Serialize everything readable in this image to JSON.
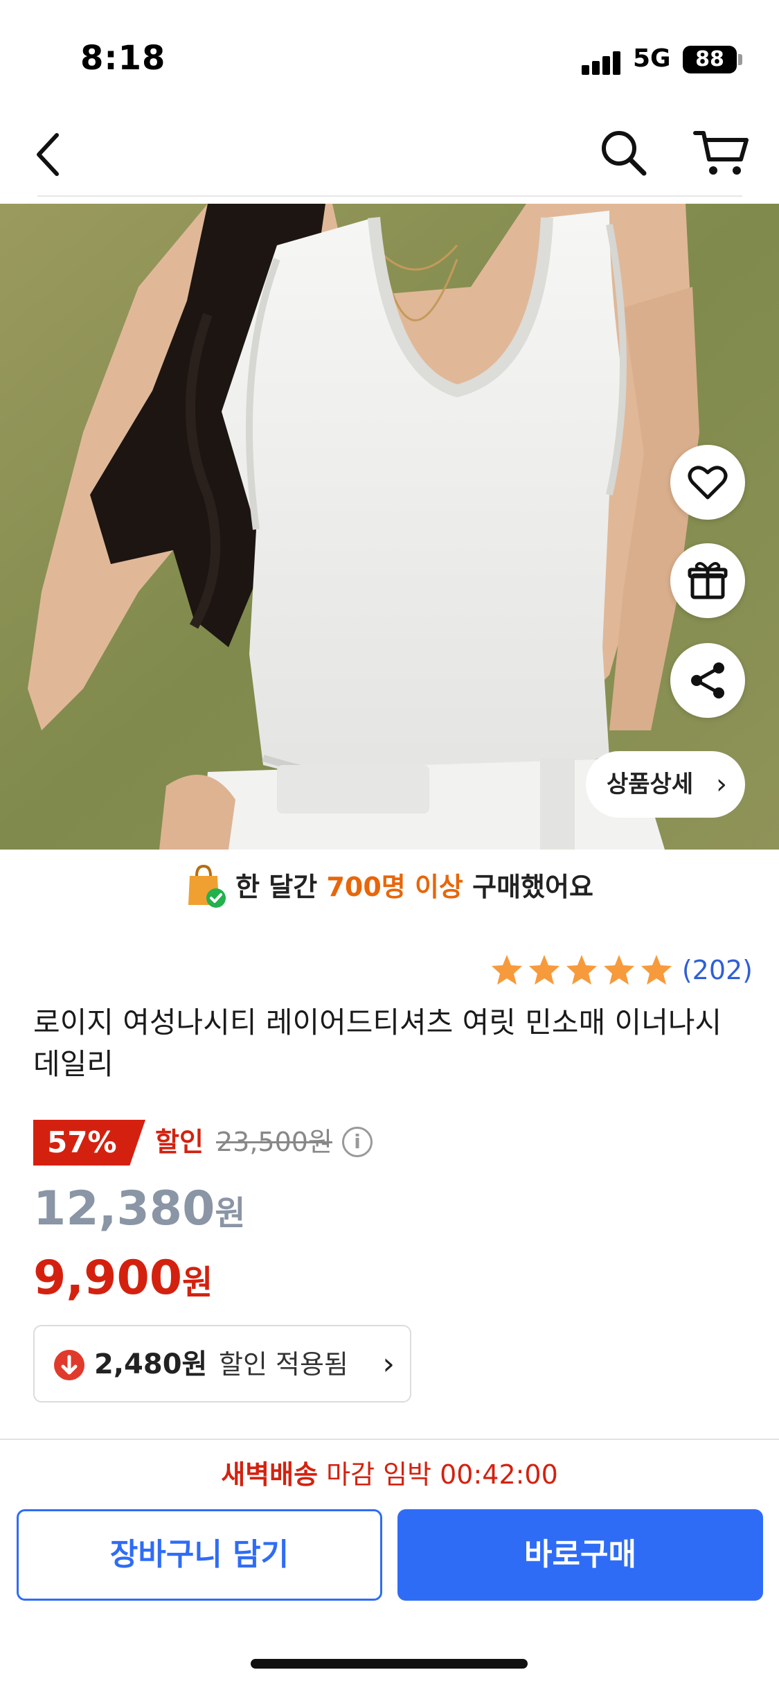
{
  "status_bar": {
    "time": "8:18",
    "network": "5G",
    "battery": "88"
  },
  "nav": {
    "back_icon": "chevron-left-icon",
    "search_icon": "search-icon",
    "cart_icon": "cart-icon"
  },
  "hero": {
    "detail_label": "상품상세",
    "detail_chevron": "›"
  },
  "banner": {
    "prefix": "한 달간 ",
    "highlight": "700명 이상",
    "suffix": " 구매했어요",
    "highlight_color": "#e8660a"
  },
  "product": {
    "rating_count": "(202)",
    "rating_stars": 5,
    "title": "로이지 여성나시티 레이어드티셔츠 여릿 민소매 이너나시 데일리"
  },
  "price": {
    "discount_percent": "57%",
    "discount_label": "할인",
    "original_price": "23,500원",
    "info_glyph": "i",
    "sale_price": "12,380",
    "final_price": "9,900",
    "currency": "원"
  },
  "coupon": {
    "amount": "2,480원",
    "label": "할인 적용됨",
    "chevron": "›"
  },
  "bottom": {
    "deadline_strong": "새벽배송",
    "deadline_text": " 마감 임박 00:42:00",
    "cart_button": "장바구니 담기",
    "buy_button": "바로구매"
  },
  "colors": {
    "accent_blue": "#2f6cf6",
    "sale_red": "#d4210f",
    "star_orange": "#f79a3c"
  }
}
